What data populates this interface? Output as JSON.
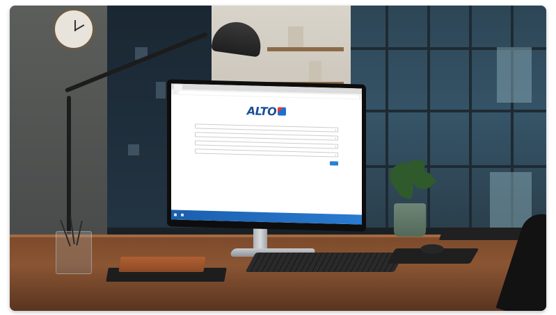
{
  "scene": {
    "description_colors": {
      "wall": "#4a4c4b",
      "desk": "#8a5533",
      "taskbar": "#2a7bd0",
      "logo_blue": "#1b4f9a",
      "logo_red": "#e23b2e"
    }
  },
  "screen": {
    "logo_text": "ALTO",
    "logo_icon": "alto-logo-icon"
  }
}
